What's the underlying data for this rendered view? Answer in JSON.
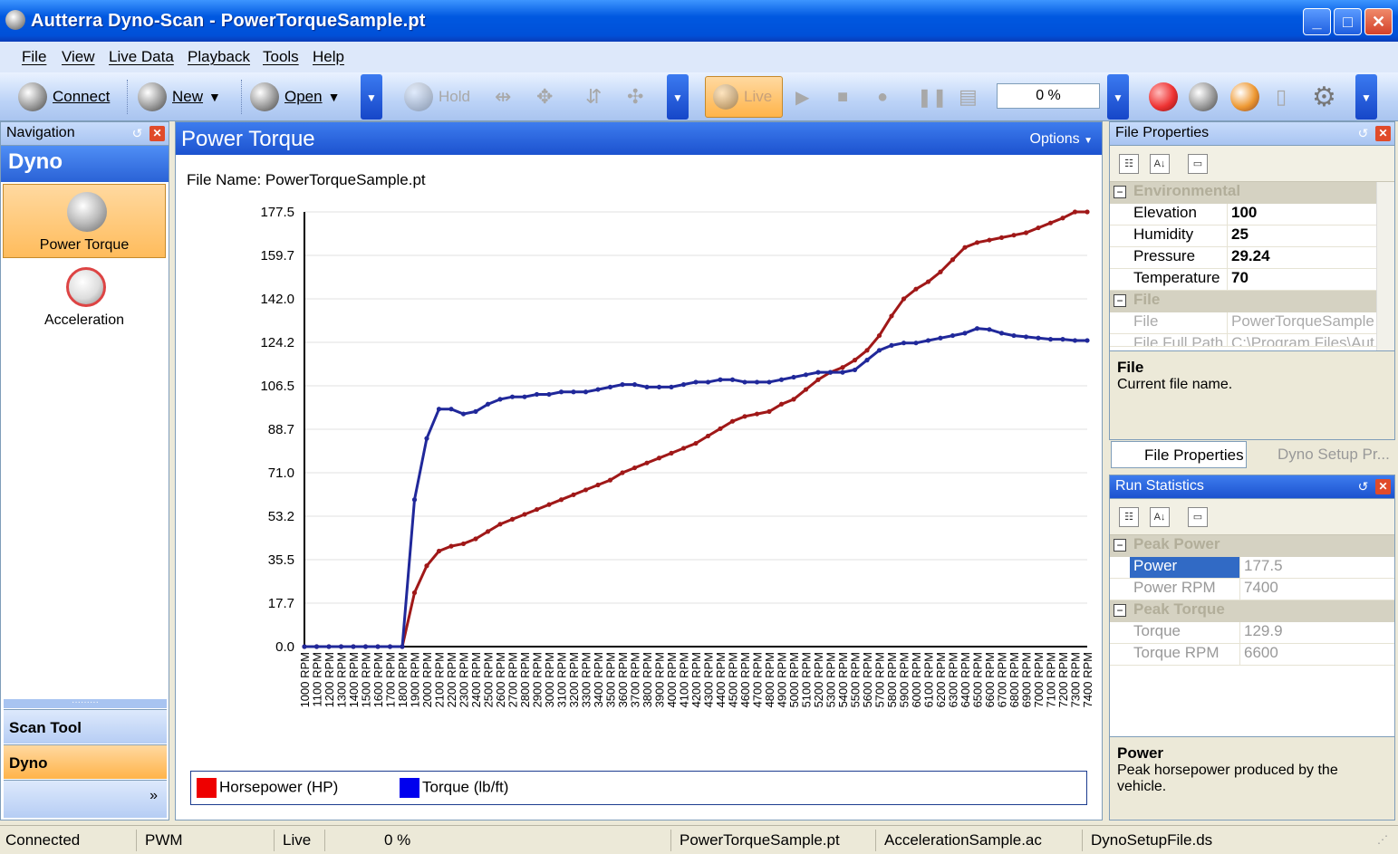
{
  "window": {
    "title": "Autterra Dyno-Scan - PowerTorqueSample.pt"
  },
  "menu": [
    "File",
    "View",
    "Live Data",
    "Playback",
    "Tools",
    "Help"
  ],
  "toolbar": {
    "connect": "Connect",
    "new": "New",
    "open": "Open",
    "hold": "Hold",
    "live": "Live",
    "progress": "0 %"
  },
  "navigation": {
    "title": "Navigation",
    "section": "Dyno",
    "items": [
      {
        "label": "Power Torque",
        "icon": "engine-icon"
      },
      {
        "label": "Acceleration",
        "icon": "speedometer-icon"
      }
    ],
    "bottom": [
      "Scan Tool",
      "Dyno"
    ]
  },
  "document": {
    "title": "Power Torque",
    "options": "Options",
    "file_name_label": "File Name: PowerTorqueSample.pt"
  },
  "chart_data": {
    "type": "line",
    "y_ticks": [
      "177.5",
      "159.7",
      "142.0",
      "124.2",
      "106.5",
      "88.7",
      "71.0",
      "53.2",
      "35.5",
      "17.7",
      "0.0"
    ],
    "ylim": [
      0,
      177.5
    ],
    "x": [
      "1000 RPM",
      "1100 RPM",
      "1200 RPM",
      "1300 RPM",
      "1400 RPM",
      "1500 RPM",
      "1600 RPM",
      "1700 RPM",
      "1800 RPM",
      "1900 RPM",
      "2000 RPM",
      "2100 RPM",
      "2200 RPM",
      "2300 RPM",
      "2400 RPM",
      "2500 RPM",
      "2600 RPM",
      "2700 RPM",
      "2800 RPM",
      "2900 RPM",
      "3000 RPM",
      "3100 RPM",
      "3200 RPM",
      "3300 RPM",
      "3400 RPM",
      "3500 RPM",
      "3600 RPM",
      "3700 RPM",
      "3800 RPM",
      "3900 RPM",
      "4000 RPM",
      "4100 RPM",
      "4200 RPM",
      "4300 RPM",
      "4400 RPM",
      "4500 RPM",
      "4600 RPM",
      "4700 RPM",
      "4800 RPM",
      "4900 RPM",
      "5000 RPM",
      "5100 RPM",
      "5200 RPM",
      "5300 RPM",
      "5400 RPM",
      "5500 RPM",
      "5600 RPM",
      "5700 RPM",
      "5800 RPM",
      "5900 RPM",
      "6000 RPM",
      "6100 RPM",
      "6200 RPM",
      "6300 RPM",
      "6400 RPM",
      "6500 RPM",
      "6600 RPM",
      "6700 RPM",
      "6800 RPM",
      "6900 RPM",
      "7000 RPM",
      "7100 RPM",
      "7200 RPM",
      "7300 RPM",
      "7400 RPM"
    ],
    "series": [
      {
        "name": "Horsepower (HP)",
        "color": "#a01818",
        "values": [
          0,
          0,
          0,
          0,
          0,
          0,
          0,
          0,
          0,
          22,
          33,
          39,
          41,
          42,
          44,
          47,
          50,
          52,
          54,
          56,
          58,
          60,
          62,
          64,
          66,
          68,
          71,
          73,
          75,
          77,
          79,
          81,
          83,
          86,
          89,
          92,
          94,
          95,
          96,
          99,
          101,
          105,
          109,
          112,
          114,
          117,
          121,
          127,
          135,
          142,
          146,
          149,
          153,
          158,
          163,
          165,
          166,
          167,
          168,
          169,
          171,
          173,
          175,
          177.5,
          177.5
        ]
      },
      {
        "name": "Torque (lb/ft)",
        "color": "#20289a",
        "values": [
          0,
          0,
          0,
          0,
          0,
          0,
          0,
          0,
          0,
          60,
          85,
          97,
          97,
          95,
          96,
          99,
          101,
          102,
          102,
          103,
          103,
          104,
          104,
          104,
          105,
          106,
          107,
          107,
          106,
          106,
          106,
          107,
          108,
          108,
          109,
          109,
          108,
          108,
          108,
          109,
          110,
          111,
          112,
          112,
          112,
          113,
          117,
          121,
          123,
          124,
          124,
          125,
          126,
          127,
          128,
          129.9,
          129.5,
          128,
          127,
          126.5,
          126,
          125.5,
          125.5,
          125,
          125
        ]
      }
    ]
  },
  "file_properties": {
    "title": "File Properties",
    "categories": [
      {
        "name": "Environmental",
        "rows": [
          [
            "Elevation",
            "100"
          ],
          [
            "Humidity",
            "25"
          ],
          [
            "Pressure",
            "29.24"
          ],
          [
            "Temperature",
            "70"
          ]
        ]
      },
      {
        "name": "File",
        "rows": [
          [
            "File",
            "PowerTorqueSample"
          ],
          [
            "File Full Path",
            "C:\\Program Files\\Aut"
          ]
        ]
      }
    ],
    "desc_title": "File",
    "desc_text": "Current file name.",
    "tabs": [
      "File Properties",
      "Dyno Setup Pr..."
    ]
  },
  "run_statistics": {
    "title": "Run Statistics",
    "categories": [
      {
        "name": "Peak Power",
        "rows": [
          [
            "Power",
            "177.5"
          ],
          [
            "Power RPM",
            "7400"
          ]
        ]
      },
      {
        "name": "Peak Torque",
        "rows": [
          [
            "Torque",
            "129.9"
          ],
          [
            "Torque RPM",
            "6600"
          ]
        ]
      }
    ],
    "desc_title": "Power",
    "desc_text": "Peak horsepower produced by the vehicle."
  },
  "status": [
    "Connected",
    "PWM",
    "Live",
    "0 %",
    "PowerTorqueSample.pt",
    "AccelerationSample.ac",
    "DynoSetupFile.ds"
  ]
}
